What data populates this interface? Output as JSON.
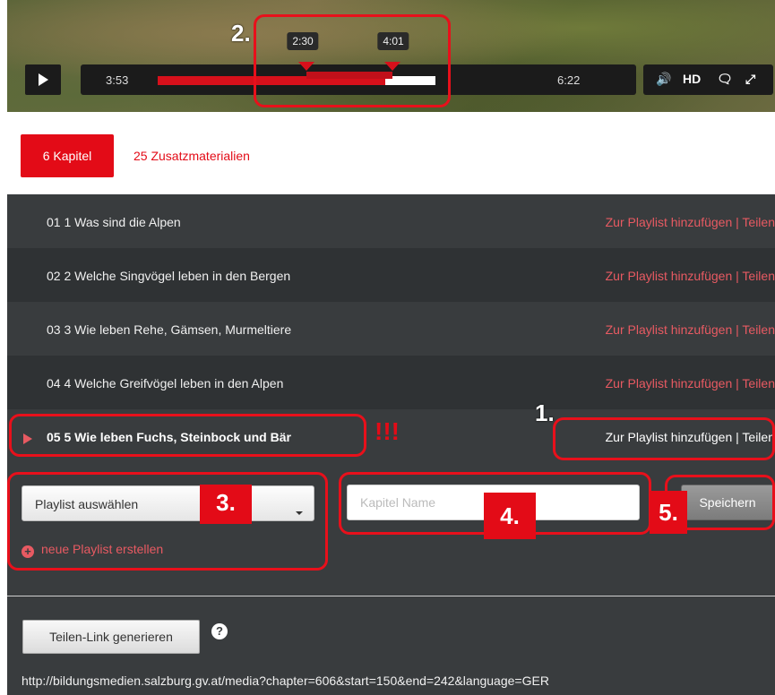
{
  "player": {
    "current_time": "3:53",
    "duration": "6:22",
    "progress_fraction": 0.82,
    "chapter_start_label": "2:30",
    "chapter_end_label": "4:01",
    "hd_label": "HD",
    "play_icon": "play-icon",
    "volume_icon": "volume-icon",
    "chat_icon": "chat-icon",
    "fullscreen_icon": "fullscreen-icon"
  },
  "tabs": {
    "active_label": "6 Kapitel",
    "other_label": "25 Zusatzmaterialien"
  },
  "chapters": [
    {
      "title": "01 1 Was sind die Alpen",
      "actions": "Zur Playlist hinzufügen | Teilen"
    },
    {
      "title": "02 2 Welche Singvögel leben in den Bergen",
      "actions": "Zur Playlist hinzufügen | Teilen"
    },
    {
      "title": "03 3 Wie leben Rehe, Gämsen, Murmeltiere",
      "actions": "Zur Playlist hinzufügen | Teilen"
    },
    {
      "title": "04 4 Welche Greifvögel leben in den Alpen",
      "actions": "Zur Playlist hinzufügen | Teilen"
    },
    {
      "title": "05 5 Wie leben Fuchs, Steinbock und Bär",
      "actions": "Zur Playlist hinzufügen | Teilen"
    }
  ],
  "form": {
    "playlist_select": "Playlist auswählen",
    "new_playlist": "neue Playlist erstellen",
    "chapter_name_placeholder": "Kapitel Name",
    "save_label": "Speichern"
  },
  "share": {
    "generate_label": "Teilen-Link generieren",
    "help_label": "?",
    "url": "http://bildungsmedien.salzburg.gv.at/media?chapter=606&start=150&end=242&language=GER"
  },
  "annotations": {
    "n1": "1.",
    "n2": "2.",
    "n3": "3.",
    "n4": "4.",
    "n5": "5.",
    "exclaim": "!!!"
  },
  "colors": {
    "accent": "#e30b17",
    "link": "#e85a62",
    "panel": "#393c3e"
  }
}
